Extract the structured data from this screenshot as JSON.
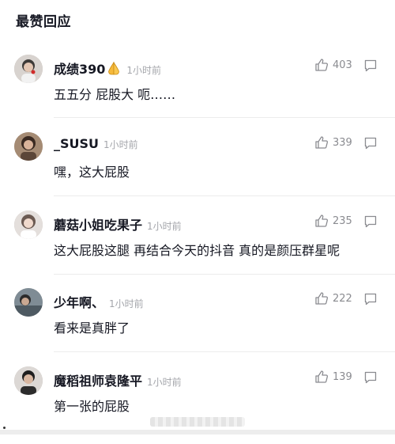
{
  "section": {
    "title": "最赞回应"
  },
  "comments": [
    {
      "username": "成绩390",
      "time": "1小时前",
      "text": "五五分 屁股大 呃……",
      "likes": "403",
      "avatar_color": "#c9c2bd"
    },
    {
      "username": "_SUSU",
      "time": "1小时前",
      "text": "嘿，这大屁股",
      "likes": "339",
      "avatar_color": "#8d6e5b"
    },
    {
      "username": "蘑菇小姐吃果子",
      "time": "1小时前",
      "text": "这大屁股这腿 再结合今天的抖音 真的是颜压群星呢",
      "likes": "235",
      "avatar_color": "#d8d2cf"
    },
    {
      "username": "少年啊、",
      "time": "1小时前",
      "text": "看来是真胖了",
      "likes": "222",
      "avatar_color": "#6e7b84"
    },
    {
      "username": "魔稻祖师袁隆平",
      "time": "1小时前",
      "text": "第一张的屁股",
      "likes": "139",
      "avatar_color": "#c7c3bf"
    }
  ],
  "colors": {
    "text": "#161823",
    "muted": "#a4a6ab",
    "icon": "#8a8b90"
  },
  "icons": {
    "like": "thumbs-up-icon",
    "reply": "comment-bubble-icon",
    "emoji": "folded-hands-emoji"
  }
}
